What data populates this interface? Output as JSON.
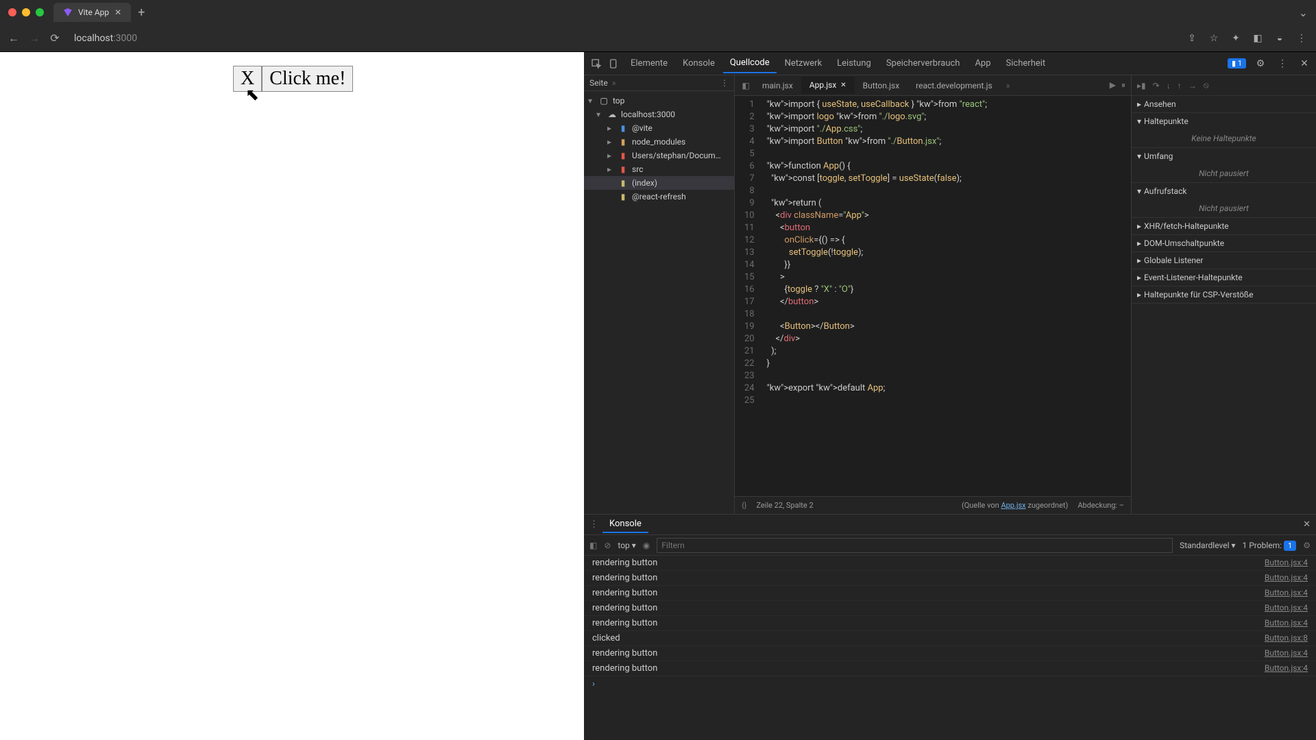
{
  "browser": {
    "tab_title": "Vite App",
    "url_host": "localhost",
    "url_port": ":3000"
  },
  "page": {
    "btn1": "X",
    "btn2": "Click me!"
  },
  "devtools": {
    "tabs": [
      "Elemente",
      "Konsole",
      "Quellcode",
      "Netzwerk",
      "Leistung",
      "Speicherverbrauch",
      "App",
      "Sicherheit"
    ],
    "active_tab": "Quellcode",
    "issues_count": "1",
    "file_panel_label": "Seite",
    "tree": {
      "top": "top",
      "host": "localhost:3000",
      "folders": [
        "@vite",
        "node_modules",
        "Users/stephan/Docum…",
        "src"
      ],
      "files": [
        "(index)",
        "@react-refresh"
      ]
    },
    "editor_tabs": [
      "main.jsx",
      "App.jsx",
      "Button.jsx",
      "react.development.js"
    ],
    "editor_active": "App.jsx",
    "code_lines": [
      {
        "n": 1,
        "t": "import { useState, useCallback } from \"react\";"
      },
      {
        "n": 2,
        "t": "import logo from \"./logo.svg\";"
      },
      {
        "n": 3,
        "t": "import \"./App.css\";"
      },
      {
        "n": 4,
        "t": "import Button from \"./Button.jsx\";"
      },
      {
        "n": 5,
        "t": ""
      },
      {
        "n": 6,
        "t": "function App() {"
      },
      {
        "n": 7,
        "t": "  const [toggle, setToggle] = useState(false);"
      },
      {
        "n": 8,
        "t": ""
      },
      {
        "n": 9,
        "t": "  return ("
      },
      {
        "n": 10,
        "t": "    <div className=\"App\">"
      },
      {
        "n": 11,
        "t": "      <button"
      },
      {
        "n": 12,
        "t": "        onClick={() => {"
      },
      {
        "n": 13,
        "t": "          setToggle(!toggle);"
      },
      {
        "n": 14,
        "t": "        }}"
      },
      {
        "n": 15,
        "t": "      >"
      },
      {
        "n": 16,
        "t": "        {toggle ? \"X\" : \"O\"}"
      },
      {
        "n": 17,
        "t": "      </button>"
      },
      {
        "n": 18,
        "t": ""
      },
      {
        "n": 19,
        "t": "      <Button></Button>"
      },
      {
        "n": 20,
        "t": "    </div>"
      },
      {
        "n": 21,
        "t": "  );"
      },
      {
        "n": 22,
        "t": "}"
      },
      {
        "n": 23,
        "t": ""
      },
      {
        "n": 24,
        "t": "export default App;"
      },
      {
        "n": 25,
        "t": ""
      }
    ],
    "status": {
      "brace": "{}",
      "pos": "Zeile 22, Spalte 2",
      "src_prefix": "(Quelle von ",
      "src_link": "App.jsx",
      "src_suffix": " zugeordnet)",
      "cov": "Abdeckung: –"
    },
    "debug_sections": {
      "watch": "Ansehen",
      "breakpoints": "Haltepunkte",
      "breakpoints_empty": "Keine Haltepunkte",
      "scope": "Umfang",
      "scope_empty": "Nicht pausiert",
      "callstack": "Aufrufstack",
      "callstack_empty": "Nicht pausiert",
      "xhr": "XHR/fetch-Haltepunkte",
      "dom": "DOM-Umschaltpunkte",
      "global": "Globale Listener",
      "event": "Event-Listener-Haltepunkte",
      "csp": "Haltepunkte für CSP-Verstöße"
    },
    "console": {
      "tab": "Konsole",
      "context": "top",
      "filter_placeholder": "Filtern",
      "level": "Standardlevel",
      "problems_label": "1 Problem:",
      "problems_count": "1",
      "logs": [
        {
          "msg": "rendering button",
          "src": "Button.jsx:4"
        },
        {
          "msg": "rendering button",
          "src": "Button.jsx:4"
        },
        {
          "msg": "rendering button",
          "src": "Button.jsx:4"
        },
        {
          "msg": "rendering button",
          "src": "Button.jsx:4"
        },
        {
          "msg": "rendering button",
          "src": "Button.jsx:4"
        },
        {
          "msg": "clicked",
          "src": "Button.jsx:8"
        },
        {
          "msg": "rendering button",
          "src": "Button.jsx:4"
        },
        {
          "msg": "rendering button",
          "src": "Button.jsx:4"
        }
      ]
    }
  }
}
